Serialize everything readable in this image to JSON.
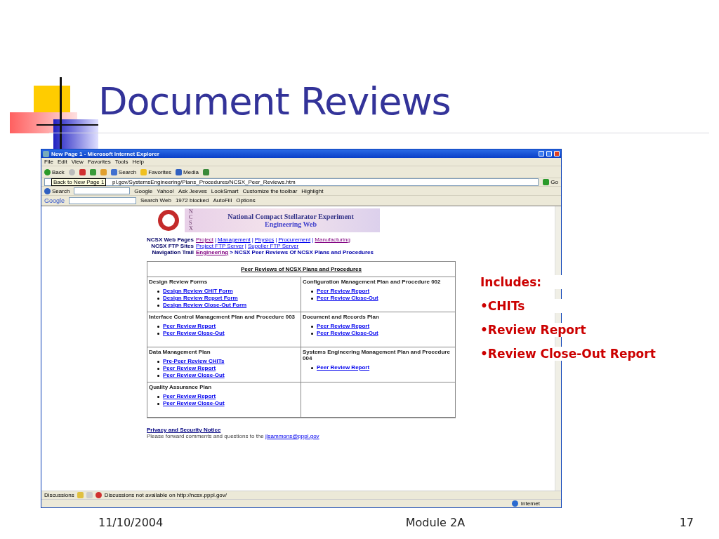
{
  "slide": {
    "title": "Document Reviews",
    "notes": {
      "heading": "Includes:",
      "bullets": [
        "•CHITs",
        "•Review Report",
        "•Review Close-Out Report"
      ]
    },
    "footer": {
      "date": "11/10/2004",
      "module": "Module 2A",
      "page": "17"
    }
  },
  "browser": {
    "title": "New Page 1 - Microsoft Internet Explorer",
    "menu": [
      "File",
      "Edit",
      "View",
      "Favorites",
      "Tools",
      "Help"
    ],
    "toolbar": [
      {
        "kind": "back",
        "label": "Back"
      },
      {
        "kind": "forward"
      },
      {
        "kind": "stop"
      },
      {
        "kind": "refresh"
      },
      {
        "kind": "home"
      },
      {
        "kind": "search",
        "label": "Search"
      },
      {
        "kind": "favorites",
        "label": "Favorites"
      },
      {
        "kind": "media",
        "label": "Media"
      },
      {
        "kind": "history"
      }
    ],
    "tooltip": "Back to New Page 1",
    "address": {
      "url": "pl.gov/SystemsEngineering/Plans_Procedures/NCSX_Peer_Reviews.htm",
      "go": "Go"
    },
    "search_toolbar": {
      "label": "Search",
      "items": [
        "Google",
        "Yahoo!",
        "Ask Jeeves",
        "LookSmart",
        "Customize the toolbar",
        "Highlight"
      ]
    },
    "google_toolbar": {
      "label": "Google",
      "items": [
        "Search Web",
        "1972 blocked",
        "AutoFill",
        "Options"
      ]
    },
    "page": {
      "banner": {
        "side_text": "NCSX",
        "line1": "National Compact Stellarator Experiment",
        "line2": "Engineering Web"
      },
      "nav": [
        {
          "label": "NCSX Web Pages",
          "links": [
            {
              "text": "Project",
              "visited": true
            },
            {
              "sep": "|",
              "text": "Management",
              "visited": false
            },
            {
              "sep": "|",
              "text": "Physics",
              "visited": false
            },
            {
              "sep": "|",
              "text": "Procurement",
              "visited": false
            },
            {
              "sep": "|",
              "text": "Manufacturing",
              "visited": true
            }
          ]
        },
        {
          "label": "NCSX FTP Sites",
          "links": [
            {
              "text": "Project FTP Server",
              "visited": false
            },
            {
              "sep": "|",
              "text": "Supplier FTP Server",
              "visited": false
            }
          ]
        }
      ],
      "trail": {
        "label": "Navigation Trail",
        "link": "Engineering",
        "rest": "> NCSX Peer Reviews Of NCSX Plans and Procedures"
      },
      "table": {
        "heading": "Peer Reviews of NCSX Plans and Procedures",
        "cells": [
          {
            "title": "Design Review Forms",
            "links": [
              "Design Review CHIT Form",
              "Design Review Report Form",
              "Design Review Close-Out Form"
            ]
          },
          {
            "title": "Configuration Management Plan and Procedure 002",
            "links": [
              "Peer Review Report",
              "Peer Review Close-Out"
            ]
          },
          {
            "title": "Interface Control Management Plan and Procedure 003",
            "links": [
              "Peer Review Report",
              "Peer Review Close-Out"
            ]
          },
          {
            "title": "Document and Records Plan",
            "links": [
              "Peer Review Report",
              "Peer Review Close-Out"
            ]
          },
          {
            "title": "Data Management Plan",
            "links": [
              "Pre-Peer Review CHITs",
              "Peer Review Report",
              "Peer Review Close-Out"
            ]
          },
          {
            "title": "Systems Engineering Management Plan and Procedure 004",
            "links": [
              "Peer Review Report"
            ]
          },
          {
            "title": "Quality Assurance Plan",
            "links": [
              "Peer Review Report",
              "Peer Review Close-Out"
            ]
          }
        ]
      },
      "footer": {
        "notice": "Privacy and Security Notice",
        "text": "Please forward comments and questions to the",
        "email": "jlsammons@pppl.gov"
      }
    },
    "discussions": {
      "label": "Discussions",
      "message": "Discussions not available on http://ncsx.pppl.gov/"
    },
    "status": {
      "zone": "Internet"
    }
  }
}
